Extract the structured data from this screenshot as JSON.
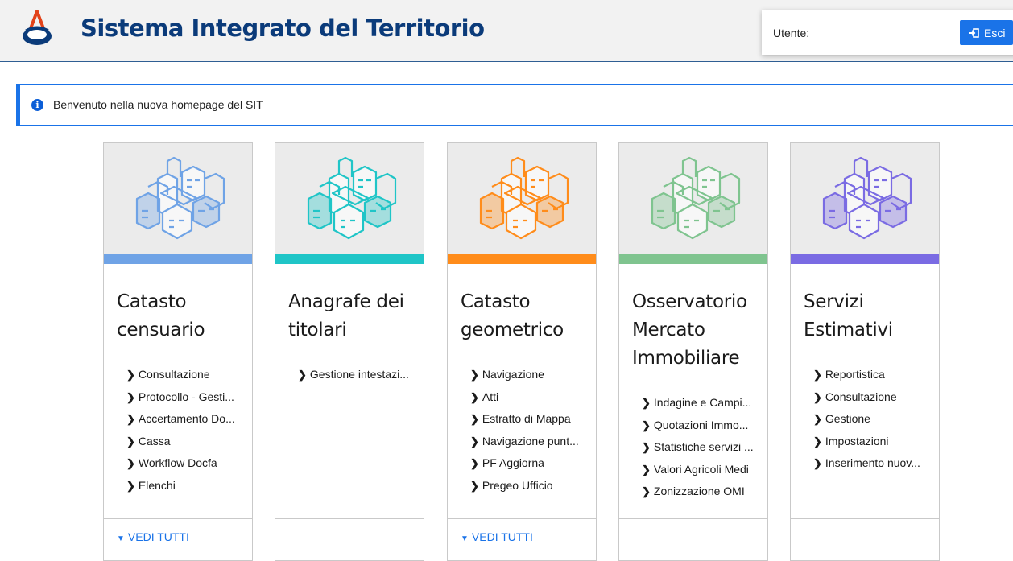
{
  "header": {
    "title": "Sistema Integrato del Territorio",
    "user_label": "Utente:",
    "logout_label": "Esci"
  },
  "alert": {
    "text": "Benvenuto nella nuova homepage del SIT"
  },
  "cards": [
    {
      "title": "Catasto censuario",
      "color": "#6fa3e6",
      "icon": "city-buildings-icon",
      "items": [
        "Consultazione",
        "Protocollo - Gesti...",
        "Accertamento Do...",
        "Cassa",
        "Workflow Docfa",
        "Elenchi"
      ],
      "see_all": "VEDI TUTTI"
    },
    {
      "title": "Anagrafe dei titolari",
      "color": "#1fc5c7",
      "icon": "city-buildings-icon",
      "items": [
        "Gestione intestazi..."
      ],
      "see_all": ""
    },
    {
      "title": "Catasto geometrico",
      "color": "#ff8c1a",
      "icon": "city-buildings-icon",
      "items": [
        "Navigazione",
        "Atti",
        "Estratto di Mappa",
        "Navigazione punt...",
        "PF Aggiorna",
        "Pregeo Ufficio"
      ],
      "see_all": "VEDI TUTTI"
    },
    {
      "title": "Osservatorio Mercato Immobiliare",
      "color": "#7fc48f",
      "icon": "city-buildings-icon",
      "items": [
        "Indagine e Campi...",
        "Quotazioni Immo...",
        "Statistiche servizi ...",
        "Valori Agricoli Medi",
        "Zonizzazione OMI"
      ],
      "see_all": ""
    },
    {
      "title": "Servizi Estimativi",
      "color": "#7a6be3",
      "icon": "city-buildings-icon",
      "items": [
        "Reportistica",
        "Consultazione",
        "Gestione",
        "Impostazioni",
        "Inserimento nuov..."
      ],
      "see_all": ""
    }
  ]
}
